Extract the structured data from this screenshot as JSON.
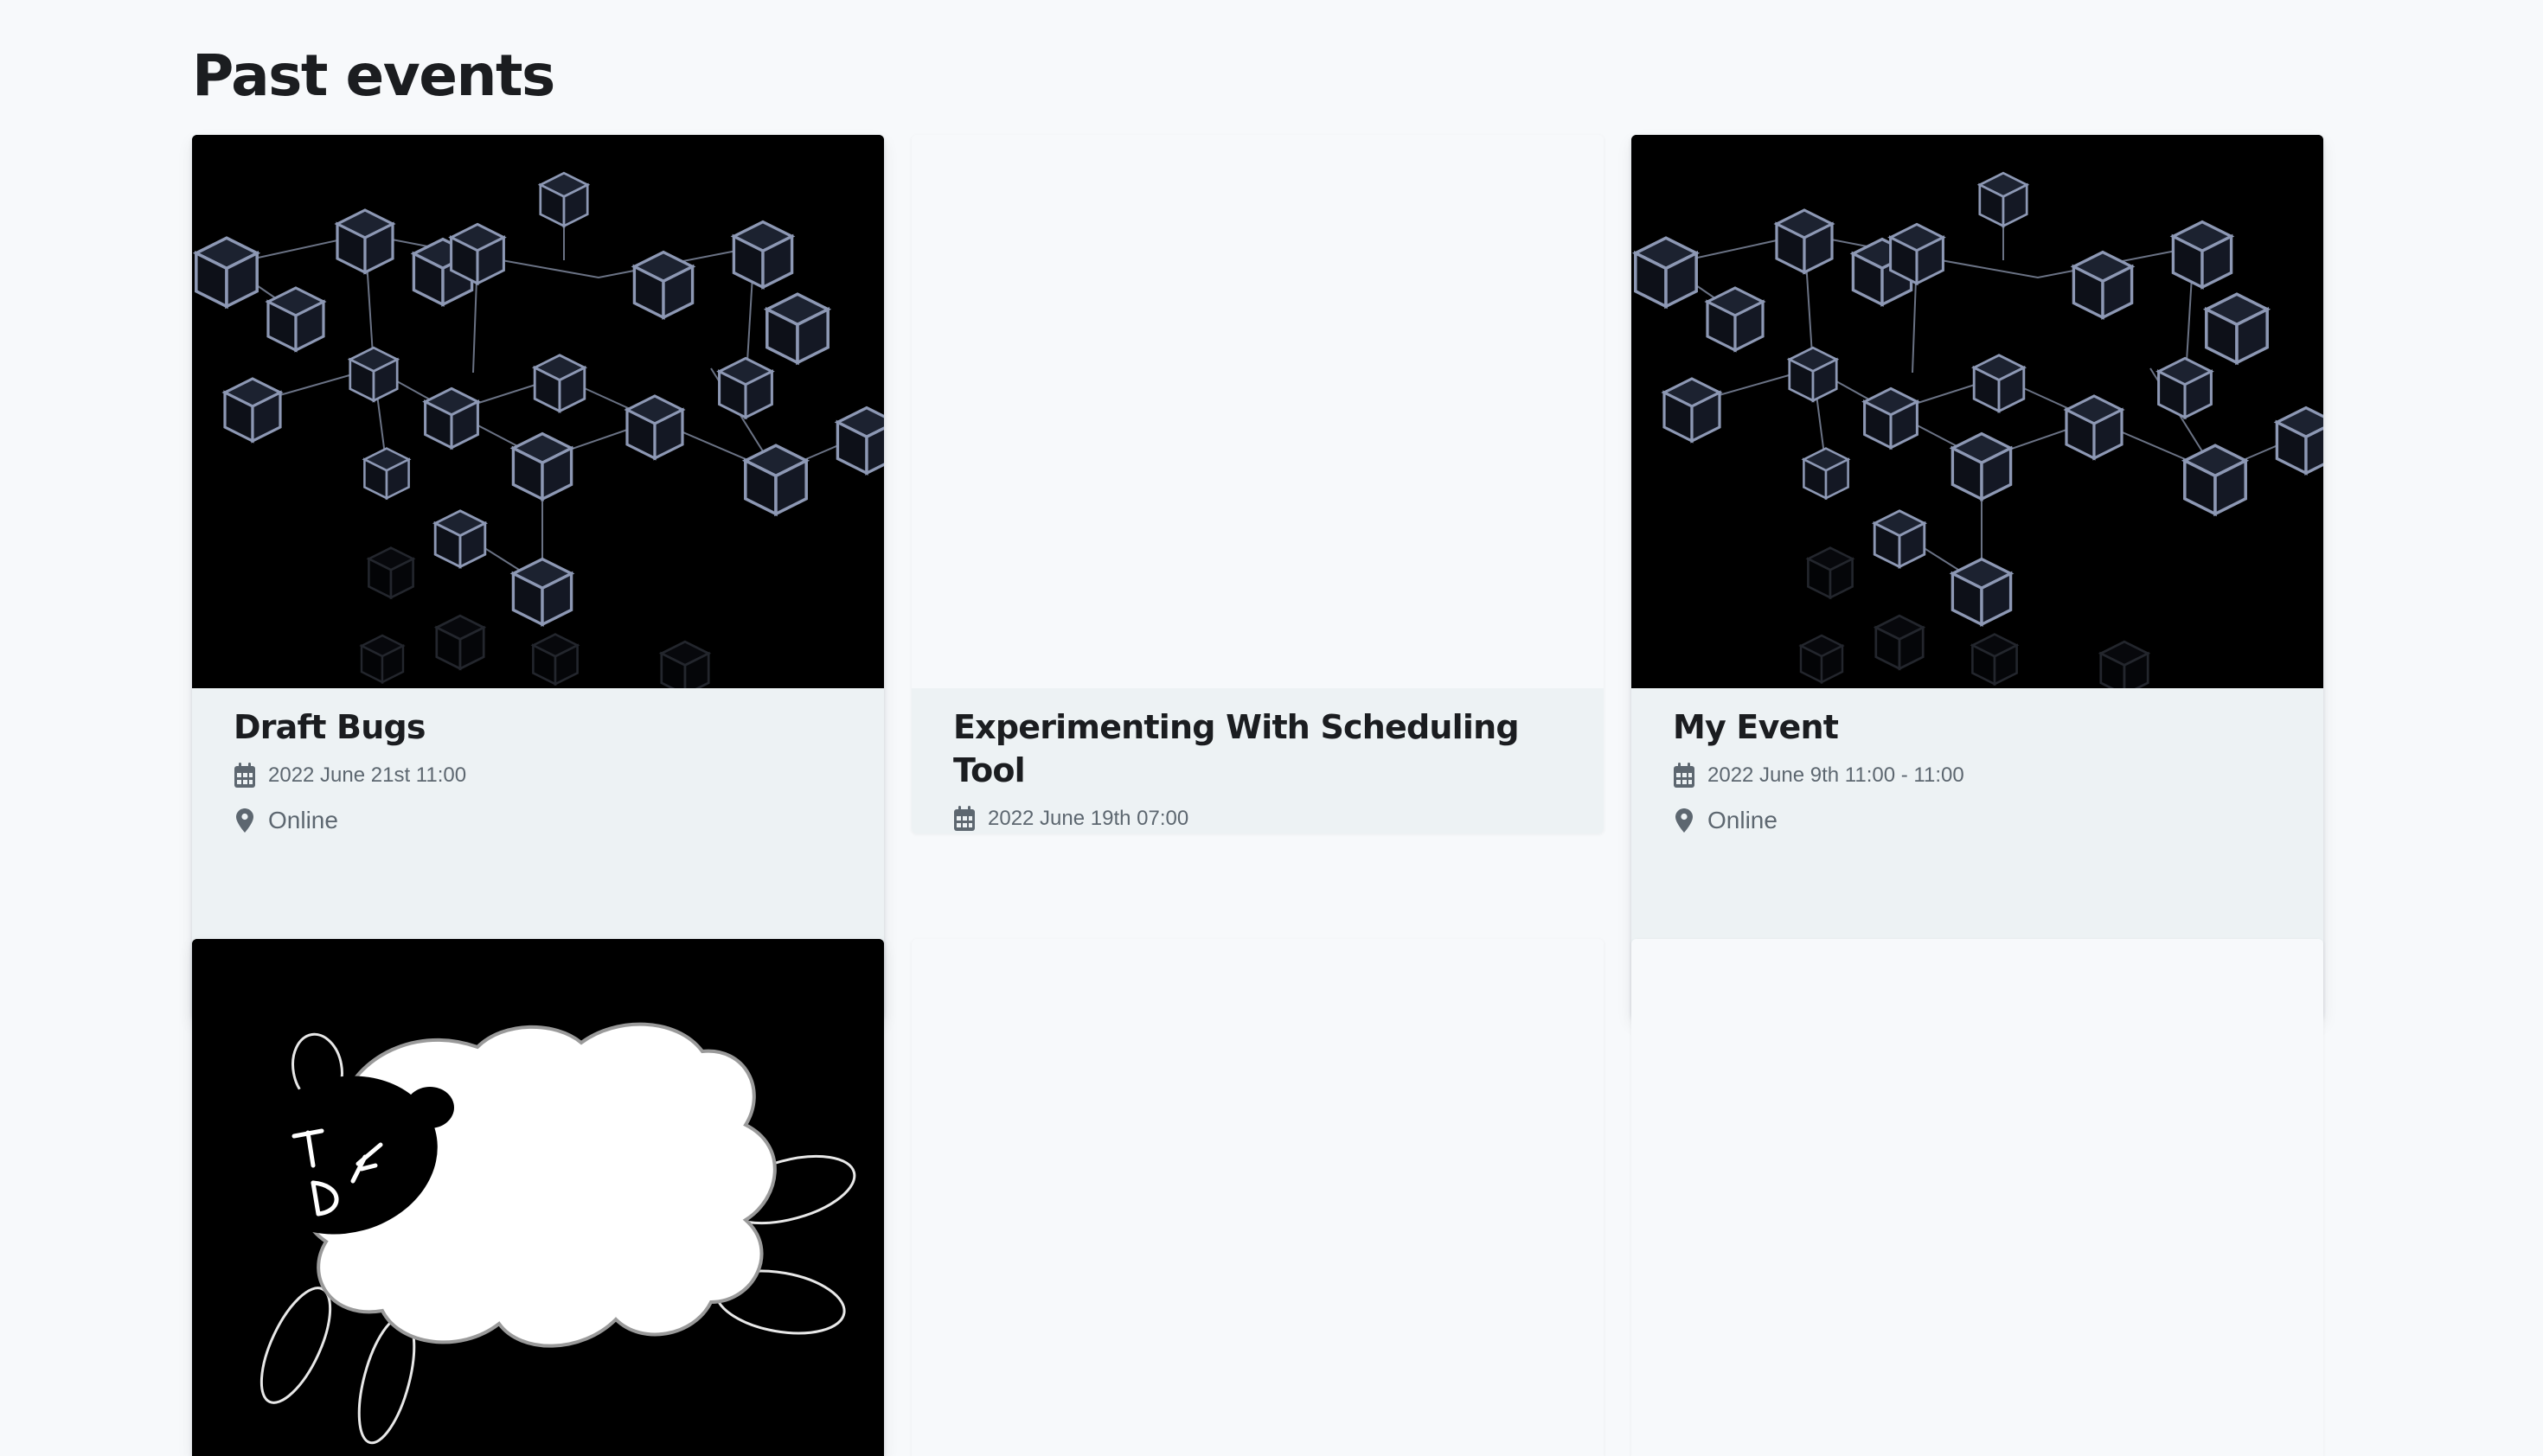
{
  "page": {
    "title": "Past events"
  },
  "events": [
    {
      "title": "Draft Bugs",
      "date": "2022 June 21st 11:00",
      "location": "Online",
      "image": "blockchain-cubes-image"
    },
    {
      "title": "Experimenting With Scheduling Tool",
      "date": "2022 June 19th 07:00",
      "location": "",
      "image": "none"
    },
    {
      "title": "My Event",
      "date": "2022 June 9th 11:00 - 11:00",
      "location": "Online",
      "image": "blockchain-cubes-image"
    },
    {
      "title": "",
      "date": "",
      "location": "",
      "image": "sheep-drawing-image"
    },
    {
      "title": "",
      "date": "",
      "location": "",
      "image": "none"
    },
    {
      "title": "",
      "date": "",
      "location": "",
      "image": "none"
    }
  ],
  "icons": {
    "date": "calendar-icon",
    "location": "location-pin-icon"
  },
  "colors": {
    "background": "#f7f9fb",
    "card_body": "#edf2f4",
    "text_primary": "#1b1d20",
    "text_secondary": "#5d6770"
  }
}
